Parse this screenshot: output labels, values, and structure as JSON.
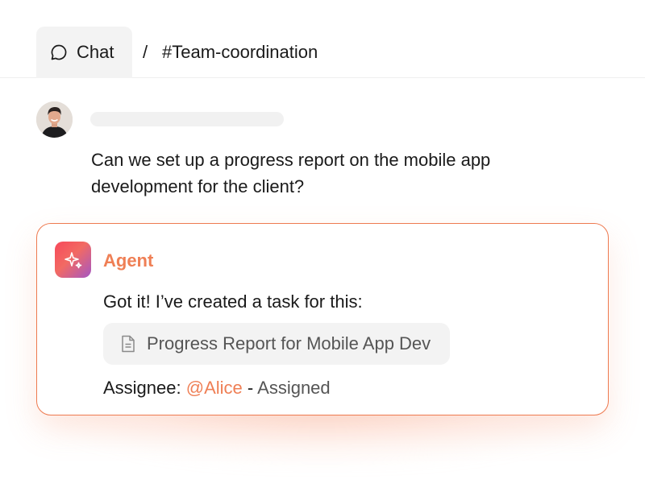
{
  "header": {
    "chat_tab_label": "Chat",
    "separator": "/",
    "channel": "#Team-coordination"
  },
  "user_message": {
    "text": "Can we set up a progress report on the mobile app development for the client?"
  },
  "agent": {
    "name": "Agent",
    "message": "Got it! I’ve created a task for this:",
    "task_title": "Progress Report for Mobile App Dev",
    "assignee_label": "Assignee:",
    "assignee_mention": "@Alice",
    "dash": "-",
    "assignee_status": "Assigned"
  },
  "icons": {
    "chat": "chat-bubble-icon",
    "agent": "sparkle-icon",
    "task": "document-icon"
  },
  "colors": {
    "accent": "#ef7f55",
    "card_border": "#ee7a50",
    "chip_bg": "#f3f3f3"
  }
}
